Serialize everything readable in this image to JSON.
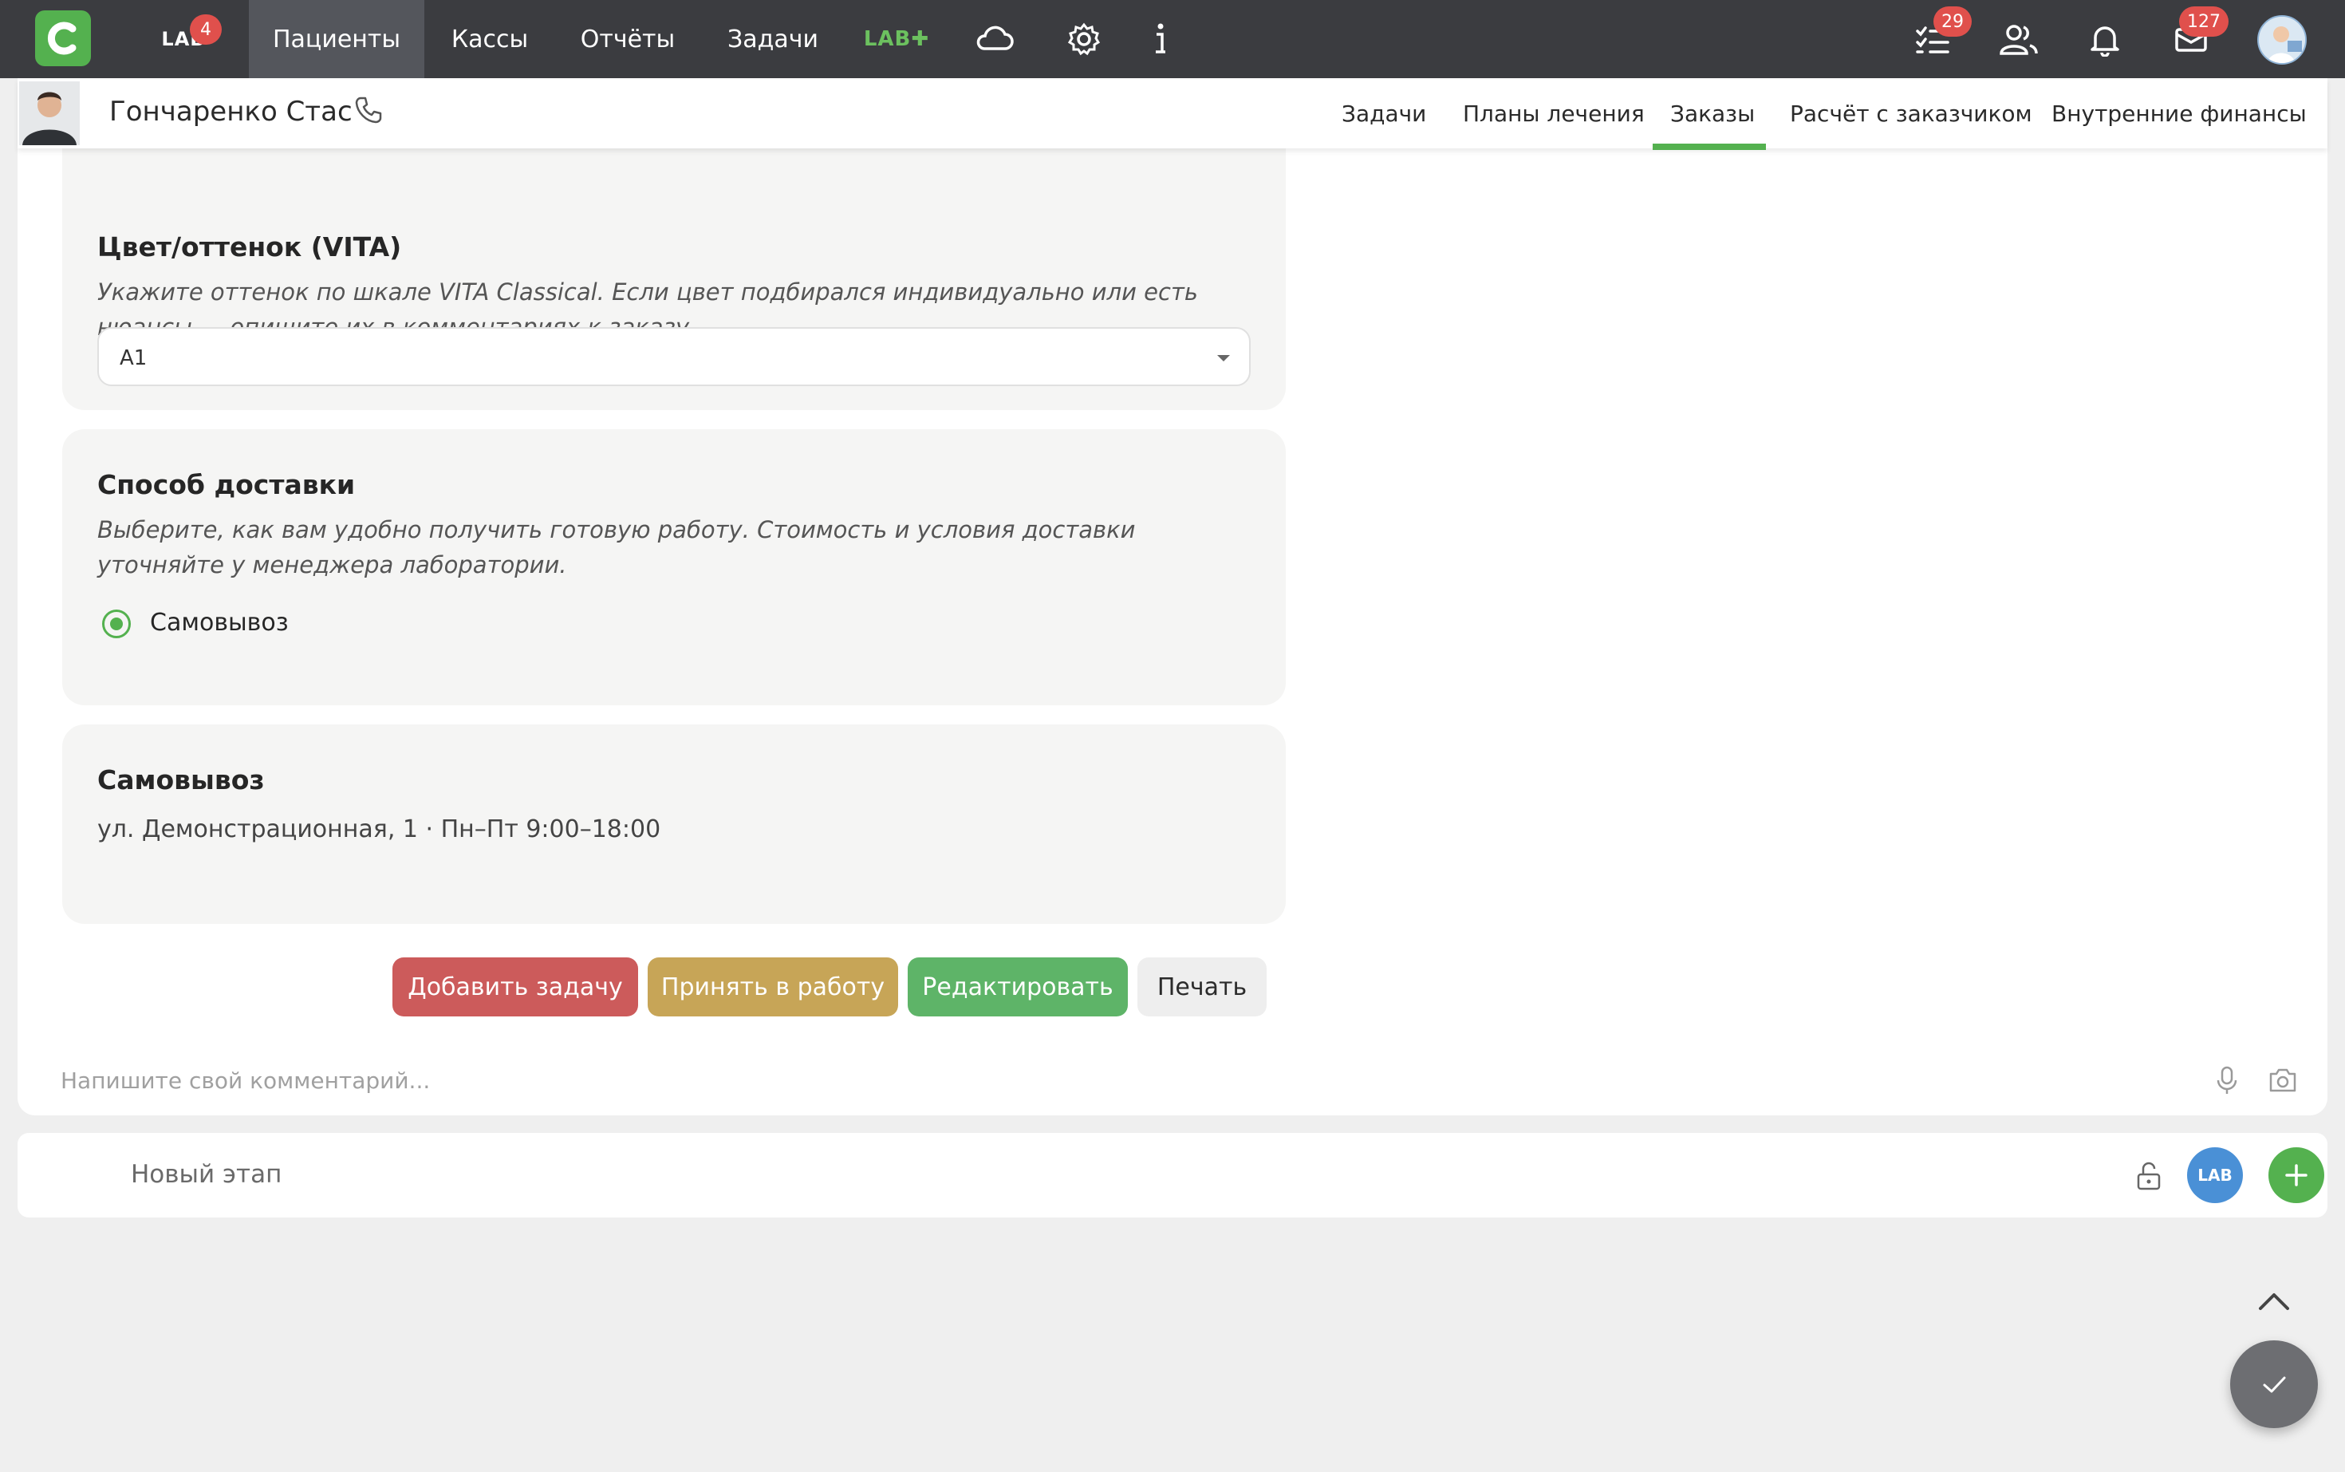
{
  "topbar": {
    "lab_label": "LAB",
    "lab_badge": "4",
    "nav": {
      "patients": "Пациенты",
      "cash": "Кассы",
      "reports": "Отчёты",
      "tasks": "Задачи",
      "labplus": "LAB✚"
    },
    "tasks_badge": "29",
    "mail_badge": "127",
    "icons": [
      "cloud-icon",
      "gear-icon",
      "info-icon",
      "checklist-icon",
      "users-icon",
      "bell-icon",
      "mail-icon"
    ]
  },
  "patient": {
    "name": "Гончаренко Стас",
    "tabs": [
      "Задачи",
      "Планы лечения",
      "Заказы",
      "Расчёт с заказчиком",
      "Внутренние финансы"
    ],
    "active_tab": "Заказы"
  },
  "color_card": {
    "title": "Цвет/оттенок (VITA)",
    "hint": "Укажите оттенок по шкале VITA Classical. Если цвет подбирался индивидуально или есть нюансы — опишите их в комментариях к заказу.",
    "selected": "A1"
  },
  "delivery_card": {
    "title": "Способ доставки",
    "hint": "Выберите, как вам удобно получить готовую работу. Стоимость и условия доставки уточняйте у менеджера лаборатории.",
    "option": "Самовывоз"
  },
  "pickup_card": {
    "title": "Самовывоз",
    "address": "ул. Демонстрационная, 1 · Пн–Пт 9:00–18:00"
  },
  "actions": {
    "add_task": "Добавить задачу",
    "accept": "Принять в работу",
    "edit": "Редактировать",
    "print": "Печать"
  },
  "comment": {
    "placeholder": "Напишите свой комментарий..."
  },
  "stage": {
    "label": "Новый этап",
    "lab_button": "LAB"
  },
  "colors": {
    "topbar": "#3b3c40",
    "accent_green": "#54b14f",
    "button_red": "#cc5b5b",
    "button_yellow": "#c7a557",
    "button_green": "#5eb468",
    "badge_red": "#e0504c",
    "lab_blue": "#4a90d6"
  }
}
